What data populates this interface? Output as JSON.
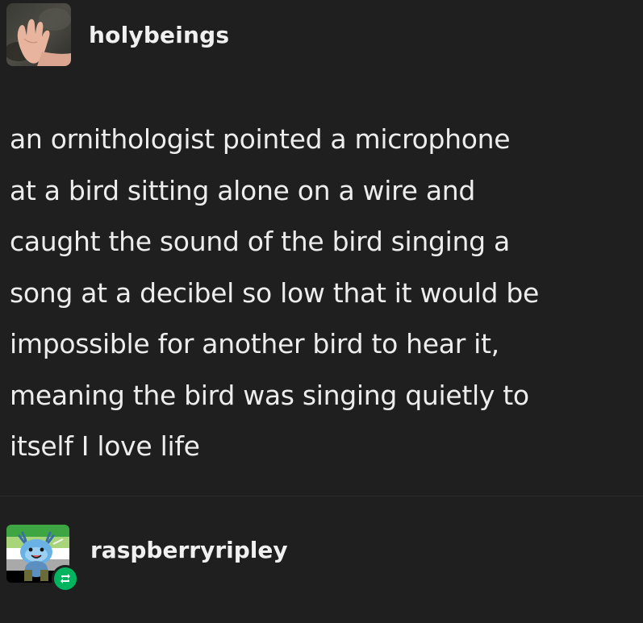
{
  "post": {
    "author": "holybeings",
    "avatar_icon": "hand-photo-avatar",
    "body_lines": [
      "an ornithologist pointed a microphone",
      "at a bird sitting alone on a wire and",
      "caught the sound of the bird singing a",
      "song at a decibel so low that it would be",
      "impossible for another bird to hear it,",
      "meaning the bird was singing quietly to",
      "itself I love life"
    ]
  },
  "reblog": {
    "author": "raspberryripley",
    "avatar_icon": "axolotl-flag-avatar",
    "badge_icon": "reblog-icon",
    "badge_color": "#00b35e"
  },
  "theme": {
    "background": "#1f1f1f",
    "text": "#ececec"
  }
}
